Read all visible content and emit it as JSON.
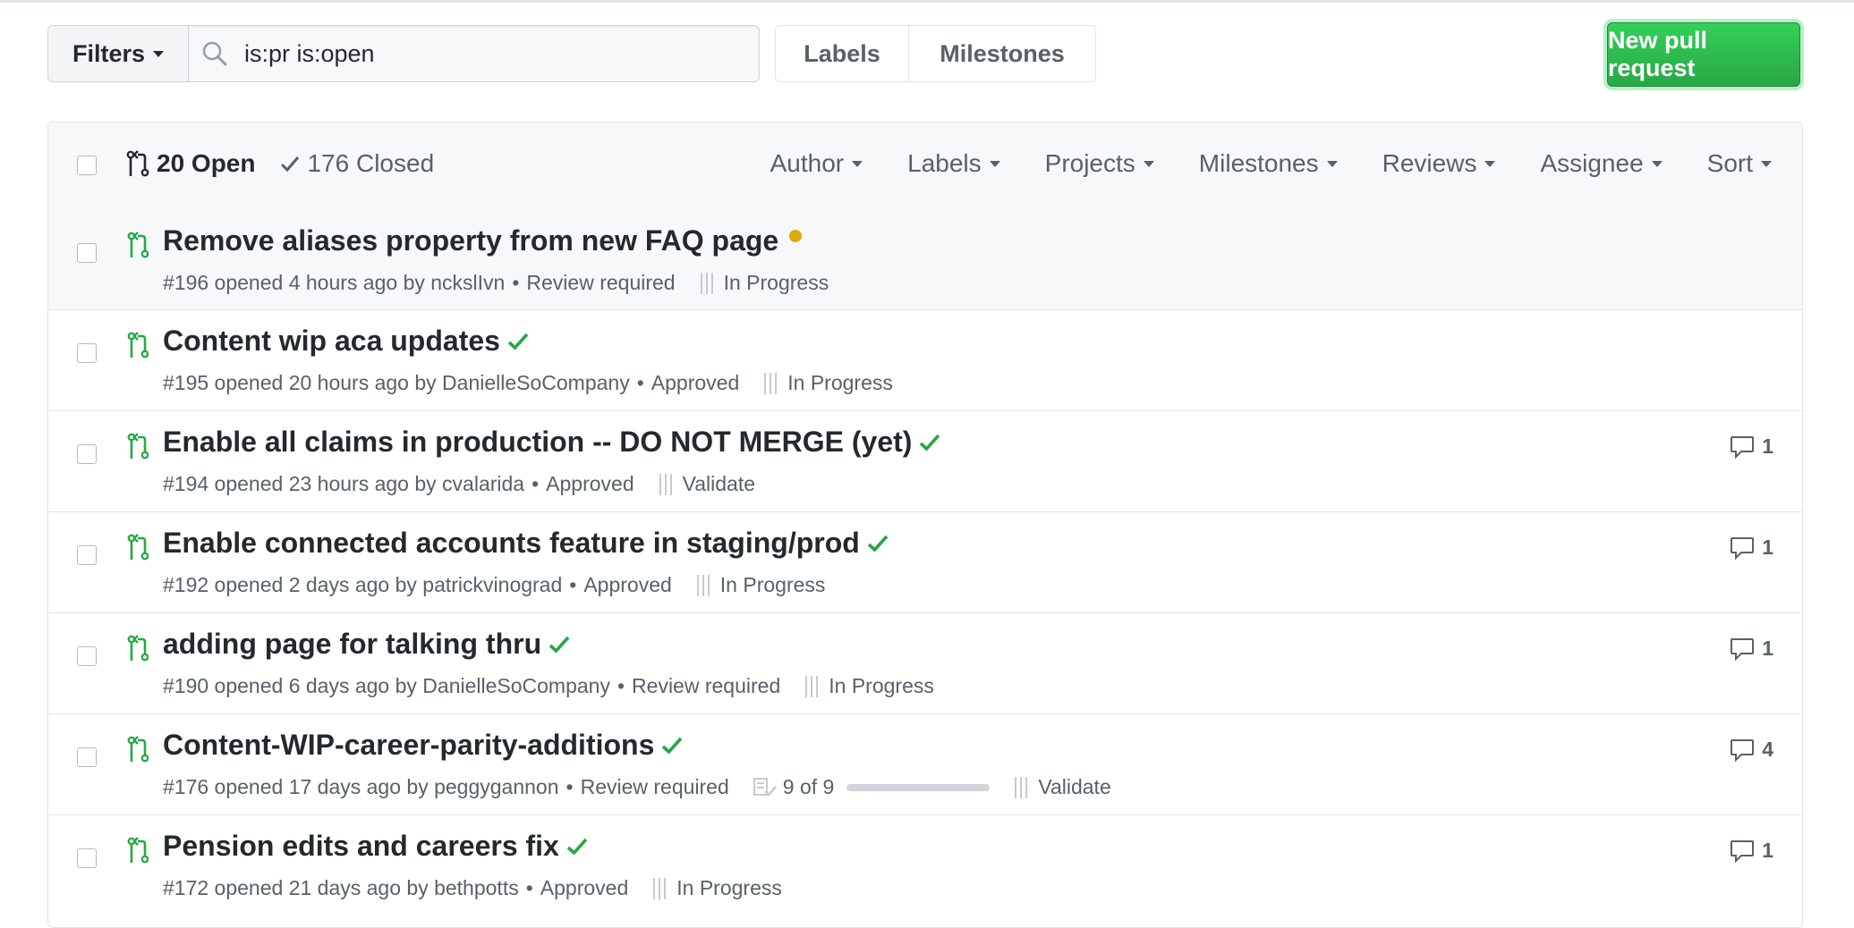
{
  "toolbar": {
    "filters_label": "Filters",
    "search_value": "is:pr is:open",
    "labels_label": "Labels",
    "milestones_label": "Milestones",
    "new_pr_label": "New pull request"
  },
  "list_header": {
    "open_label": "20 Open",
    "closed_label": "176 Closed",
    "facets": [
      "Author",
      "Labels",
      "Projects",
      "Milestones",
      "Reviews",
      "Assignee",
      "Sort"
    ]
  },
  "colors": {
    "green": "#28a745",
    "pending": "#dbab09",
    "muted": "#586069"
  },
  "pull_requests": [
    {
      "title": "Remove aliases property from new FAQ page",
      "status": "pending",
      "meta": "#196 opened 4 hours ago by nckslIvn",
      "review": "Review required",
      "project": "In Progress",
      "comments": ""
    },
    {
      "title": "Content wip aca updates",
      "status": "success",
      "meta": "#195 opened 20 hours ago by DanielleSoCompany",
      "review": "Approved",
      "project": "In Progress",
      "comments": ""
    },
    {
      "title": "Enable all claims in production -- DO NOT MERGE (yet)",
      "status": "success",
      "meta": "#194 opened 23 hours ago by cvalarida",
      "review": "Approved",
      "project": "Validate",
      "comments": "1"
    },
    {
      "title": "Enable connected accounts feature in staging/prod",
      "status": "success",
      "meta": "#192 opened 2 days ago by patrickvinograd",
      "review": "Approved",
      "project": "In Progress",
      "comments": "1"
    },
    {
      "title": "adding page for talking thru",
      "status": "success",
      "meta": "#190 opened 6 days ago by DanielleSoCompany",
      "review": "Review required",
      "project": "In Progress",
      "comments": "1"
    },
    {
      "title": "Content-WIP-career-parity-additions",
      "status": "success",
      "meta": "#176 opened 17 days ago by peggygannon",
      "review": "Review required",
      "tasks": "9 of 9",
      "tasks_complete": 1.0,
      "project": "Validate",
      "comments": "4"
    },
    {
      "title": "Pension edits and careers fix",
      "status": "success",
      "meta": "#172 opened 21 days ago by bethpotts",
      "review": "Approved",
      "project": "In Progress",
      "comments": "1"
    }
  ]
}
